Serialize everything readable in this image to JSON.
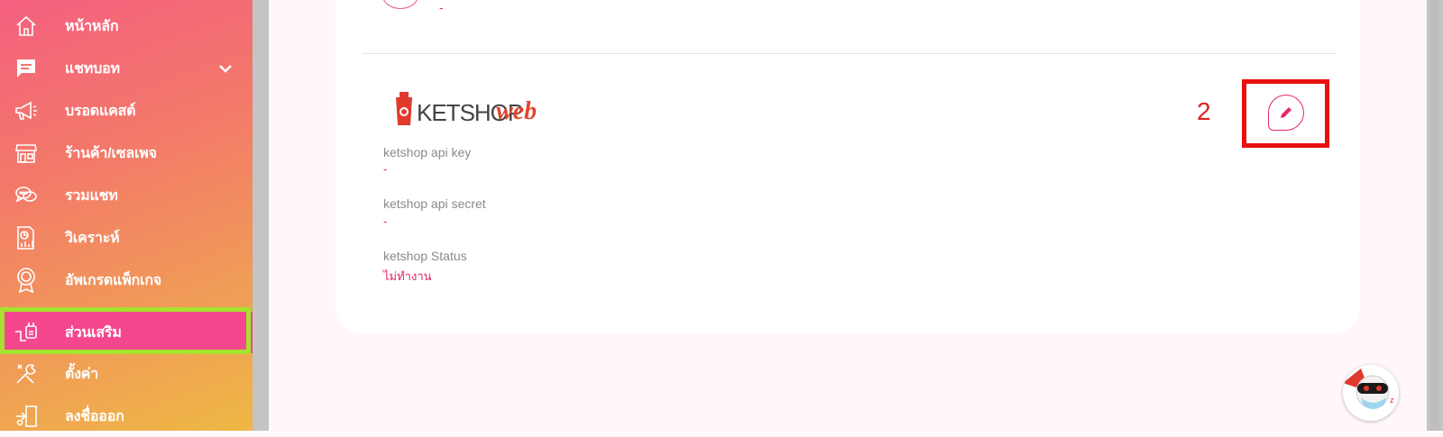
{
  "sidebar": {
    "items": [
      {
        "label": "หน้าหลัก",
        "icon": "home-icon"
      },
      {
        "label": "แชทบอท",
        "icon": "chat-icon"
      },
      {
        "label": "บรอดแคสต์",
        "icon": "megaphone-icon"
      },
      {
        "label": "ร้านค้า/เซลเพจ",
        "icon": "store-icon"
      },
      {
        "label": "รวมแชท",
        "icon": "chats-icon"
      },
      {
        "label": "วิเคราะห์",
        "icon": "analytics-icon"
      },
      {
        "label": "อัพเกรดแพ็กเกจ",
        "icon": "award-icon"
      },
      {
        "label": "ส่วนเสริม",
        "icon": "plugin-icon"
      },
      {
        "label": "ตั้งค่า",
        "icon": "tools-icon"
      },
      {
        "label": "ลงชื่อออก",
        "icon": "logout-icon"
      }
    ],
    "active_index": 7
  },
  "panel": {
    "prev_value": "-",
    "logo_text_main": "KETSHOP",
    "logo_text_accent": "web",
    "fields": [
      {
        "label": "ketshop api key",
        "value": "-"
      },
      {
        "label": "ketshop api secret",
        "value": "-"
      },
      {
        "label": "ketshop Status",
        "value": "ไม่ทำงาน"
      }
    ],
    "step_number": "2"
  },
  "colors": {
    "accent": "#e8256e",
    "active_highlight": "#a6e22e",
    "annotation": "#e81010"
  }
}
